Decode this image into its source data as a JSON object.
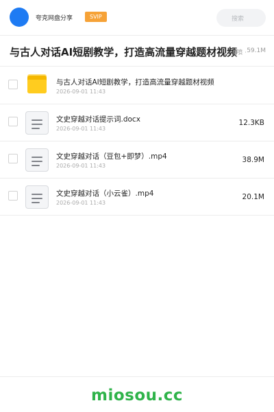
{
  "header": {
    "brand": "夸克网盘分享",
    "badge": "SVIP",
    "search_label": "搜索"
  },
  "share": {
    "title": "与古人对话AI短剧教学，打造高流量穿越题材视频",
    "meta_partial": "噴 ·",
    "total_size": "59.1M"
  },
  "files": [
    {
      "name": "与古人对话AI短剧教学，打造高流量穿越题材视频",
      "date": "2026-09-01 11:43",
      "size": "",
      "type": "folder-icon"
    },
    {
      "name": "文史穿越对话提示词.docx",
      "date": "2026-09-01 11:43",
      "size": "12.3KB",
      "type": "document-icon"
    },
    {
      "name": "文史穿越对话（豆包+即梦）.mp4",
      "date": "2026-09-01 11:43",
      "size": "38.9M",
      "type": "document-icon"
    },
    {
      "name": "文史穿越对话（小云雀）.mp4",
      "date": "2026-09-01 11:43",
      "size": "20.1M",
      "type": "document-icon"
    }
  ],
  "footer": {
    "watermark": "miosou.cc"
  },
  "colors": {
    "accent_blue": "#1e7bf3",
    "badge_orange": "#f6a237",
    "folder_yellow": "#ffcc1f",
    "watermark_green": "#2fb34a"
  }
}
